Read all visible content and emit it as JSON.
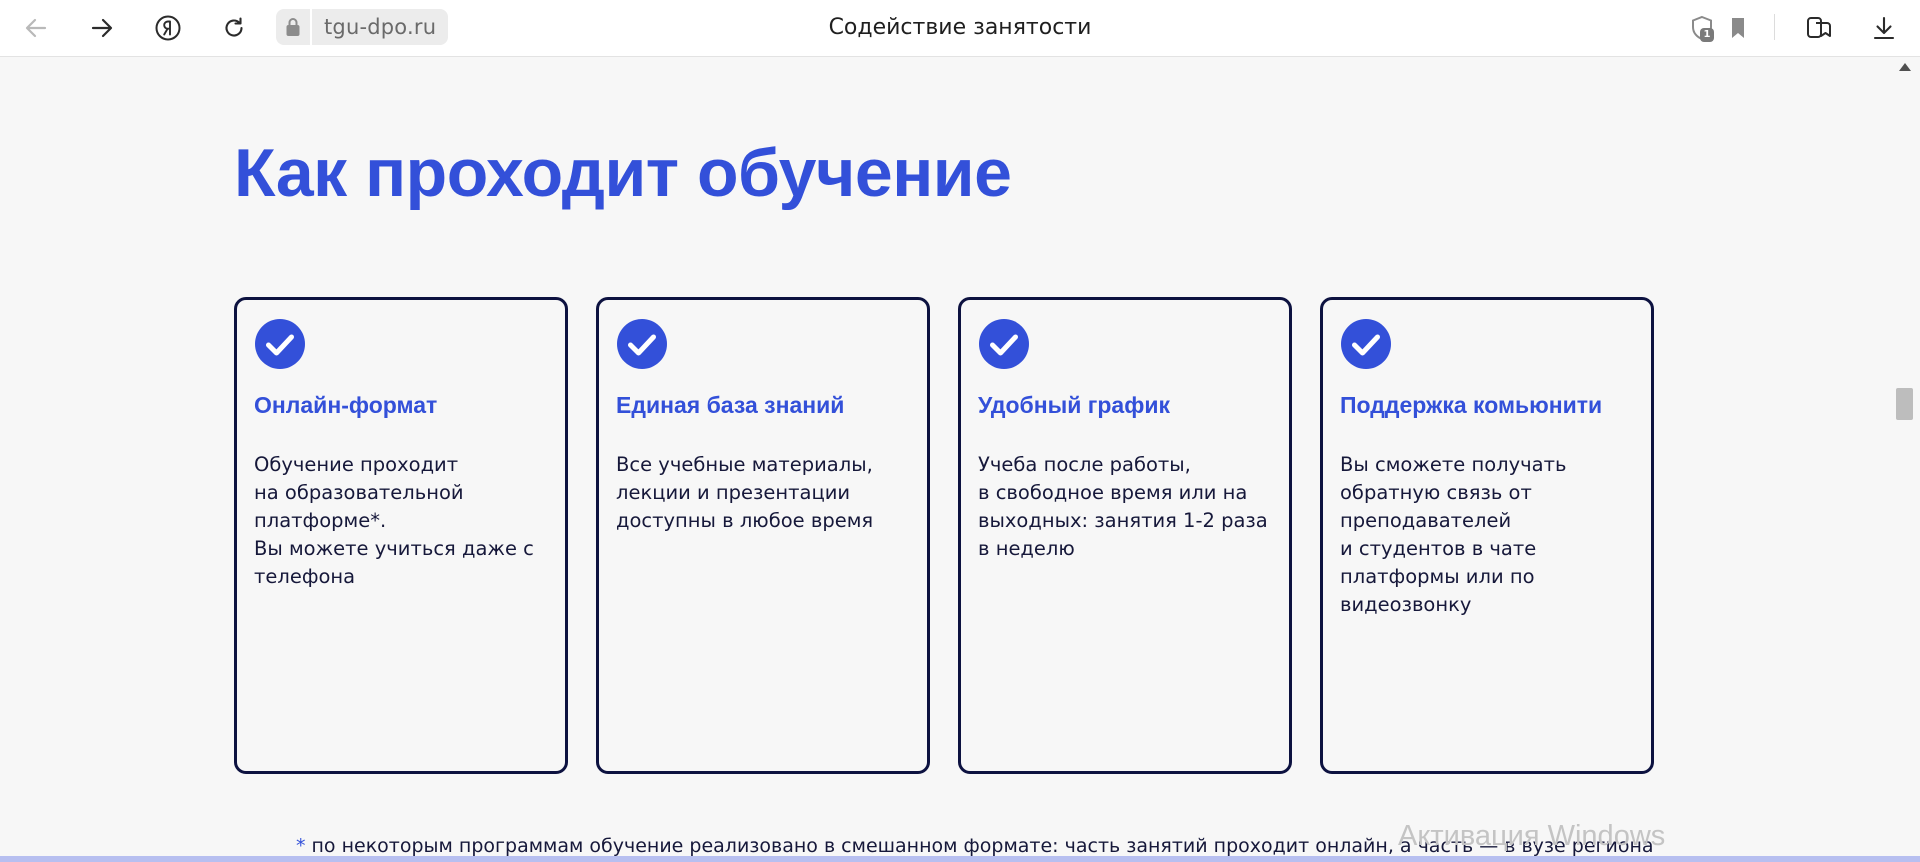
{
  "browser": {
    "url": "tgu-dpo.ru",
    "tab_title": "Содействие занятости",
    "protect_badge": "1",
    "icons": [
      "back-icon",
      "forward-icon",
      "yandex-logo-icon",
      "reload-icon",
      "lock-icon",
      "protect-shield-icon",
      "bookmark-icon",
      "collections-icon",
      "download-icon"
    ]
  },
  "section": {
    "heading": "Как проходит обучение"
  },
  "cards": [
    {
      "title": "Онлайн-формат",
      "text": "Обучение проходит\nна образовательной\nплатформе*.\nВы можете учиться даже с\nтелефона"
    },
    {
      "title": "Единая база знаний",
      "text": "Все учебные материалы,\nлекции и презентации\nдоступны в любое время"
    },
    {
      "title": "Удобный график",
      "text": "Учеба после работы,\nв свободное время или на\nвыходных: занятия 1-2 раза\nв неделю"
    },
    {
      "title": "Поддержка комьюнити",
      "text": "Вы сможете получать\nобратную связь от\nпреподавателей\nи студентов в чате\nплатформы или по\nвидеозвонку"
    }
  ],
  "footnote": {
    "star": "*",
    "text": "по некоторым программам обучение реализовано в смешанном формате: часть занятий проходит онлайн, а часть — в вузе региона"
  },
  "watermark": "Активация Windows",
  "colors": {
    "accent": "#3350d9",
    "card_border": "#0d1240",
    "text": "#16183a",
    "background": "#f7f7f7"
  }
}
